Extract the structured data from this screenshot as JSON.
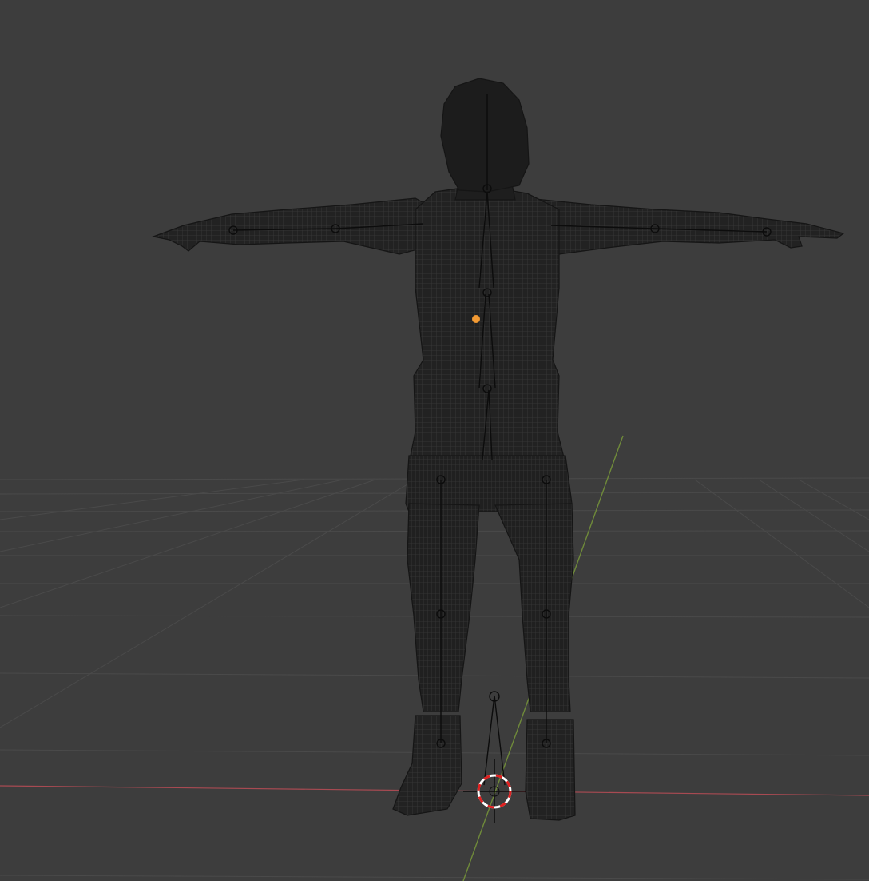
{
  "viewport": {
    "background_color": "#3d3d3d",
    "grid_line_color": "#4a4a4a",
    "x_axis_color": "#a84a52",
    "y_axis_color": "#6f8a3a",
    "mesh_color": "#1e1e1e",
    "mesh_line_color": "#2c2c2c",
    "armature_color": "#0c0c0c",
    "origin_point_color": "#f29a33",
    "cursor_colors": [
      "#e02020",
      "#ffffff"
    ]
  },
  "scene": {
    "object": "character-mesh-wireframe",
    "armature": "character-armature",
    "selected_origin": "origin-point",
    "cursor": "3d-cursor"
  }
}
